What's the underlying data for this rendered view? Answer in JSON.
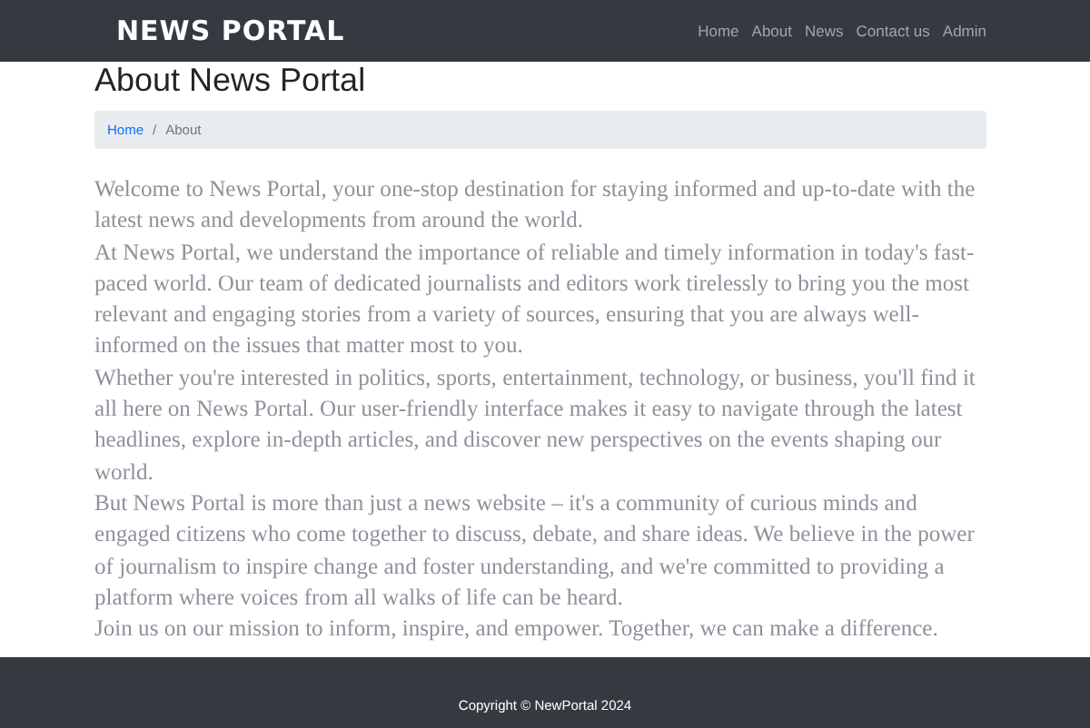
{
  "navbar": {
    "brand": "NEWS PORTAL",
    "links": [
      {
        "label": "Home",
        "selected": false
      },
      {
        "label": "About",
        "selected": false
      },
      {
        "label": "News",
        "selected": false
      },
      {
        "label": "Contact us",
        "selected": false
      },
      {
        "label": "Admin",
        "selected": false
      }
    ]
  },
  "page_title": "About News Portal",
  "breadcrumb_separator": "/",
  "breadcrumb": [
    {
      "label": "Home",
      "kind": "link"
    },
    {
      "label": "About",
      "kind": "current"
    }
  ],
  "paragraphs": [
    "Welcome to News Portal, your one-stop destination for staying informed and up-to-date with the latest news and developments from around the world.",
    "At News Portal, we understand the importance of reliable and timely information in today's fast-paced world. Our team of dedicated journalists and editors work tirelessly to bring you the most relevant and engaging stories from a variety of sources, ensuring that you are always well-informed on the issues that matter most to you.",
    "Whether you're interested in politics, sports, entertainment, technology, or business, you'll find it all here on News Portal. Our user-friendly interface makes it easy to navigate through the latest headlines, explore in-depth articles, and discover new perspectives on the events shaping our world.",
    "But News Portal is more than just a news website – it's a community of curious minds and engaged citizens who come together to discuss, debate, and share ideas. We believe in the power of journalism to inspire change and foster understanding, and we're committed to providing a platform where voices from all walks of life can be heard.",
    "Join us on our mission to inform, inspire, and empower. Together, we can make a difference."
  ],
  "footer": {
    "copyright": "Copyright © NewPortal 2024"
  }
}
